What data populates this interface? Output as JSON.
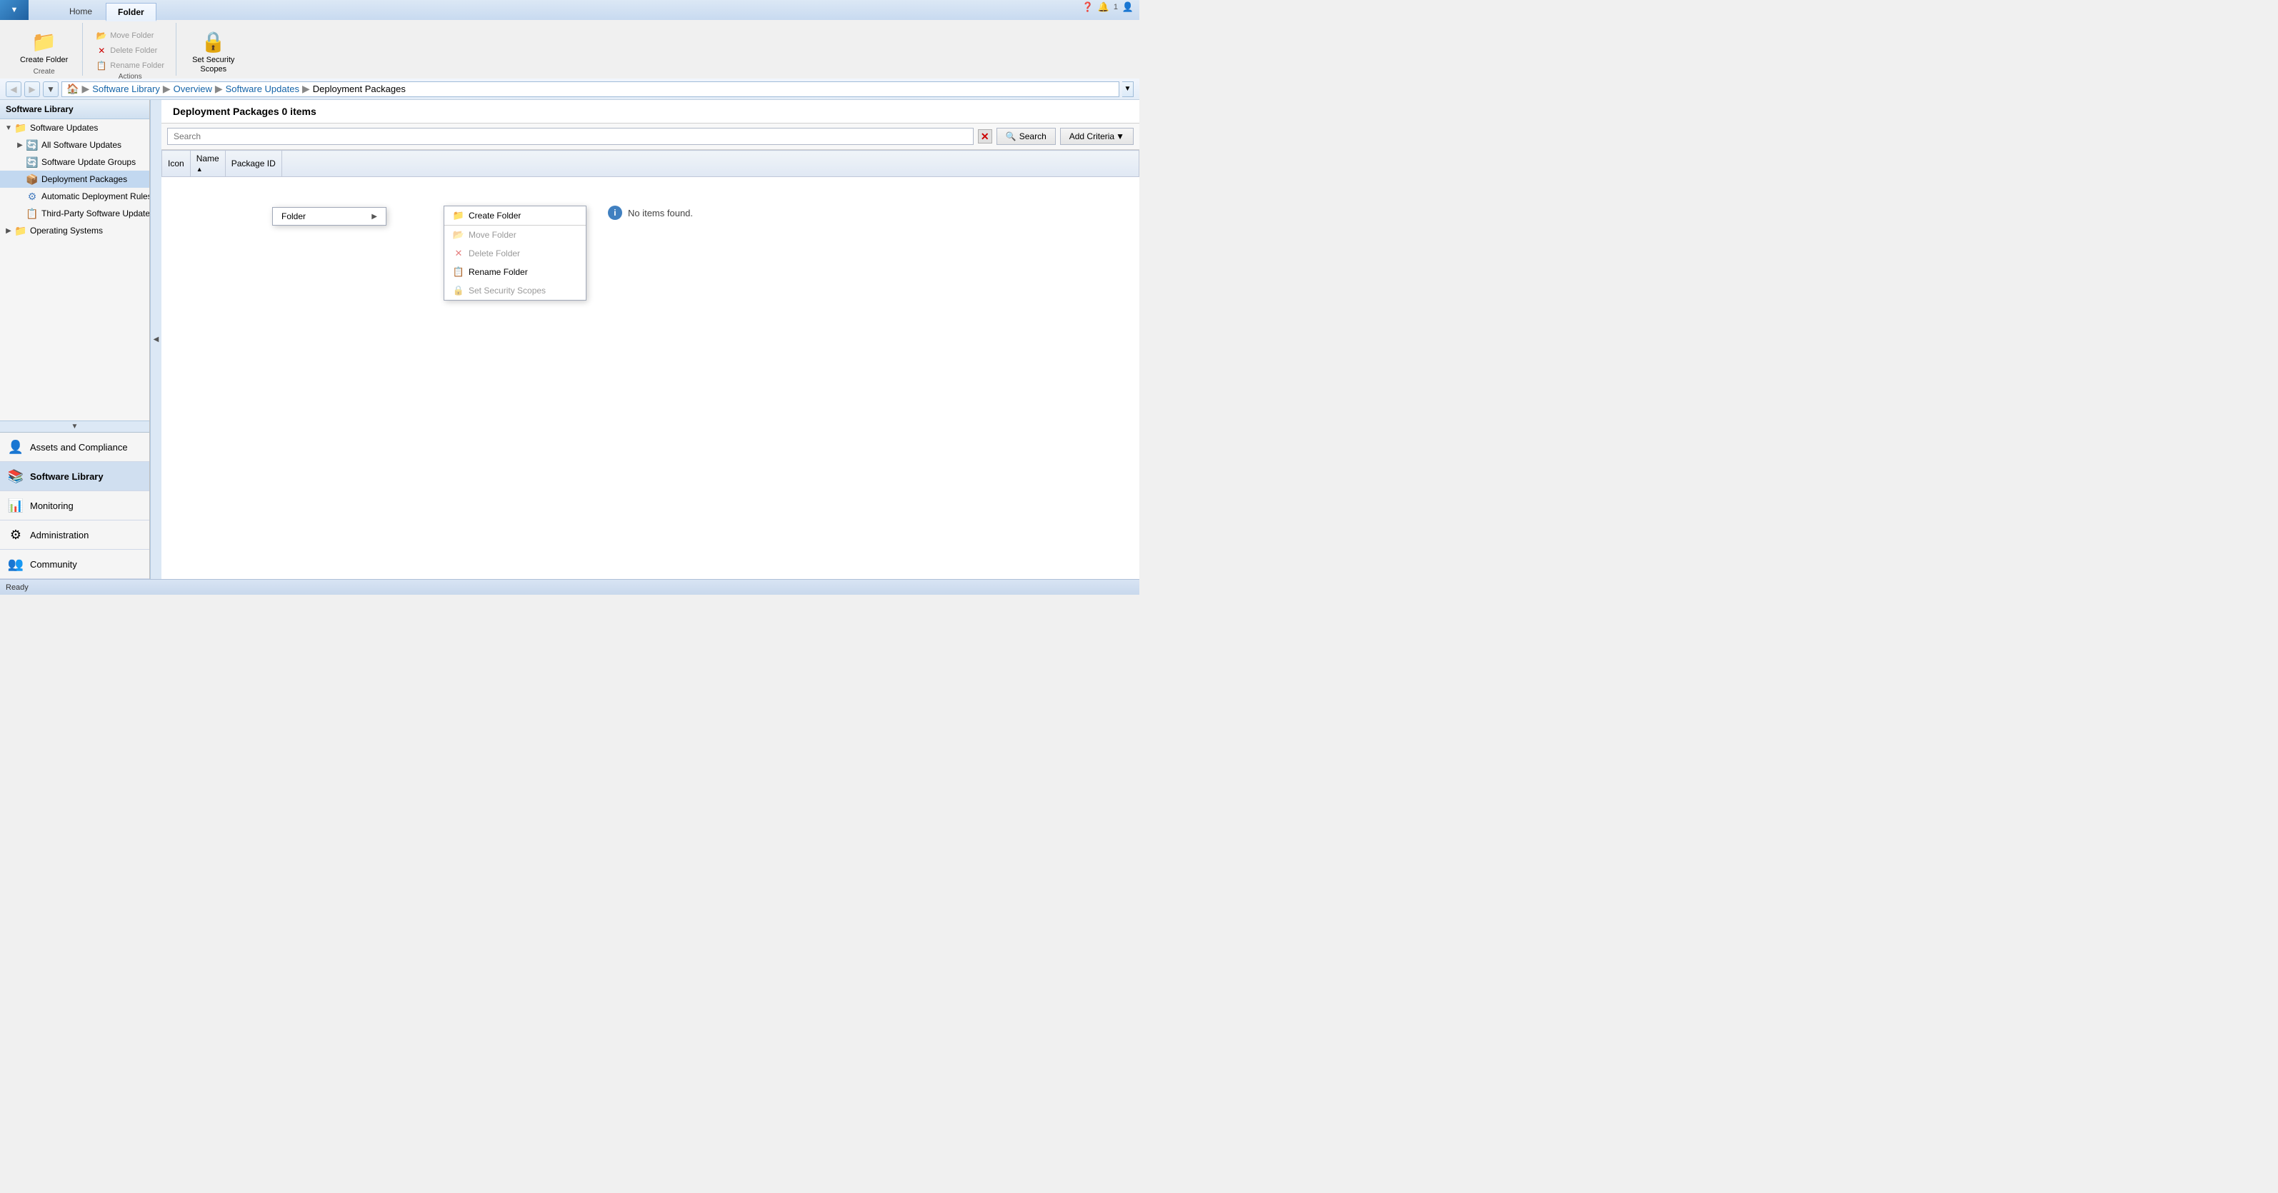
{
  "titleBar": {
    "controls": [
      "minimize",
      "maximize",
      "close"
    ]
  },
  "ribbon": {
    "appButton": "▼",
    "tabs": [
      {
        "label": "Home",
        "active": false
      },
      {
        "label": "Folder",
        "active": true
      }
    ],
    "groups": [
      {
        "label": "Create",
        "items": [
          {
            "type": "large",
            "label": "Create\nFolder",
            "icon": "📁"
          }
        ]
      },
      {
        "label": "Actions",
        "items": [
          {
            "type": "small",
            "label": "Move Folder",
            "icon": "📂",
            "disabled": true
          },
          {
            "type": "small",
            "label": "Delete Folder",
            "icon": "✕",
            "disabled": true
          },
          {
            "type": "small",
            "label": "Rename Folder",
            "icon": "📋",
            "disabled": true
          }
        ]
      },
      {
        "label": "",
        "items": [
          {
            "type": "large",
            "label": "Set Security\nScopes",
            "icon": "🔒"
          }
        ]
      }
    ]
  },
  "navBar": {
    "backBtn": "◀",
    "forwardBtn": "▶",
    "upBtn": "▲",
    "homeIcon": "🏠",
    "breadcrumbs": [
      {
        "label": "Software Library",
        "link": true
      },
      {
        "label": "Overview",
        "link": true
      },
      {
        "label": "Software Updates",
        "link": true
      },
      {
        "label": "Deployment Packages",
        "link": false
      }
    ]
  },
  "sidebar": {
    "header": "Software Library",
    "tree": [
      {
        "indent": 0,
        "expandable": true,
        "expanded": true,
        "icon": "📁",
        "label": "Software Updates",
        "selected": false,
        "iconColor": "#f5a623"
      },
      {
        "indent": 1,
        "expandable": true,
        "expanded": false,
        "icon": "🔄",
        "label": "All Software Updates",
        "selected": false,
        "iconColor": "#4a7fc0"
      },
      {
        "indent": 1,
        "expandable": false,
        "expanded": false,
        "icon": "🔄",
        "label": "Software Update Groups",
        "selected": false,
        "iconColor": "#4a7fc0"
      },
      {
        "indent": 1,
        "expandable": false,
        "expanded": false,
        "icon": "📦",
        "label": "Deployment Packages",
        "selected": true,
        "iconColor": "#4a7fc0"
      },
      {
        "indent": 1,
        "expandable": false,
        "expanded": false,
        "icon": "⚙",
        "label": "Automatic Deployment Rules",
        "selected": false,
        "iconColor": "#4a7fc0"
      },
      {
        "indent": 1,
        "expandable": false,
        "expanded": false,
        "icon": "📋",
        "label": "Third-Party Software Update Catalogs",
        "selected": false,
        "iconColor": "#4a7fc0"
      },
      {
        "indent": 0,
        "expandable": true,
        "expanded": false,
        "icon": "📁",
        "label": "Operating Systems",
        "selected": false,
        "iconColor": "#f5a623"
      }
    ],
    "sections": [
      {
        "icon": "👤",
        "label": "Assets and Compliance",
        "active": false
      },
      {
        "icon": "📚",
        "label": "Software Library",
        "active": true
      },
      {
        "icon": "📊",
        "label": "Monitoring",
        "active": false
      },
      {
        "icon": "⚙",
        "label": "Administration",
        "active": false
      },
      {
        "icon": "👥",
        "label": "Community",
        "active": false
      }
    ]
  },
  "content": {
    "header": "Deployment Packages 0 items",
    "search": {
      "placeholder": "Search",
      "buttonLabel": "Search",
      "addCriteriaLabel": "Add Criteria"
    },
    "table": {
      "columns": [
        "Icon",
        "Name",
        "Package ID"
      ],
      "rows": []
    },
    "noItemsMessage": "No items found."
  },
  "contextMenu": {
    "items": [
      {
        "label": "Folder",
        "hasSubmenu": true,
        "icon": "",
        "disabled": false
      }
    ]
  },
  "folderSubmenu": {
    "items": [
      {
        "label": "Create Folder",
        "icon": "📁",
        "disabled": false
      },
      {
        "label": "Move Folder",
        "icon": "📂",
        "disabled": true
      },
      {
        "label": "Delete Folder",
        "icon": "✕",
        "disabled": true
      },
      {
        "label": "Rename Folder",
        "icon": "📋",
        "disabled": false
      },
      {
        "label": "Set Security Scopes",
        "icon": "🔒",
        "disabled": true
      }
    ]
  },
  "statusBar": {
    "text": "Ready"
  }
}
